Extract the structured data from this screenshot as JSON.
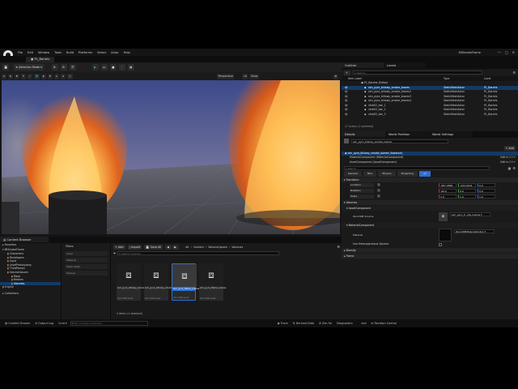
{
  "menu": [
    "File",
    "Edit",
    "Window",
    "Tools",
    "Build",
    "Platforms",
    "Select",
    "Actor",
    "Help"
  ],
  "window_title": "MISmokeFlame",
  "level_tab": "PL_Barrels",
  "toolbar": {
    "mode": "Selection Mode"
  },
  "viewport": {
    "perspective": "Perspective",
    "lit": "Lit"
  },
  "outliner": {
    "title": "Outliner",
    "levels_tab": "Levels",
    "search_placeholder": "Search...",
    "columns": [
      "Item Label",
      "Type",
      "Level"
    ],
    "root": "PL_Barrels (Editor)",
    "rows": [
      {
        "label": "sim_pyro_billowy_smoke_lowres",
        "type": "StaticMeshActor",
        "level": "PL_Barrels"
      },
      {
        "label": "sim_pyro_billowy_smoke_lowres2",
        "type": "StaticMeshActor",
        "level": "PL_Barrels"
      },
      {
        "label": "sim_pyro_billowy_smoke_lowres3",
        "type": "StaticMeshActor",
        "level": "PL_Barrels"
      },
      {
        "label": "sim_pyro_billowy_smoke_lowres4",
        "type": "StaticMeshActor",
        "level": "PL_Barrels"
      },
      {
        "label": "vfxb02_bar_1",
        "type": "StaticMeshActor",
        "level": "PL_Barrels"
      },
      {
        "label": "vfxb02_bar_2",
        "type": "StaticMeshActor",
        "level": "PL_Barrels"
      },
      {
        "label": "vfxb02_bar_3",
        "type": "StaticMeshActor",
        "level": "PL_Barrels"
      }
    ],
    "footer": "17 actors (1 selected)"
  },
  "details": {
    "tabs": [
      "Details",
      "World Partition",
      "World Settings"
    ],
    "actor_name": "sim_pyro_billowy_smoke_lowres",
    "add_label": "Add",
    "components": [
      "sim_pyro_billowy_smoke_lowres (Instance)",
      "MaterialComponent (MaterialComponent)",
      "AssetComponent (AssetComponent)"
    ],
    "edit_in_cpp": "Edit in C++",
    "search_placeholder": "Search",
    "filter_tabs": [
      "General",
      "Misc",
      "Physics",
      "Streaming",
      "All"
    ],
    "transform": {
      "section": "Transform",
      "location_label": "Location",
      "location": [
        "-967.0884",
        "-294.9224",
        "0.0"
      ],
      "rotation_label": "Rotation",
      "rotation": [
        "-90.0",
        "0.0",
        "0.0"
      ],
      "scale_label": "Scale",
      "scale": [
        "1.0",
        "1.0",
        "1.0"
      ]
    },
    "volumes_section": "Volumes",
    "asset_section": "AssetComponent",
    "zero_vdb_label": "ZeroVDB Volume",
    "zero_vdb_value": "sim_pyro_b..olw_lowres",
    "material_section": "MaterialComponent",
    "material_label": "Material",
    "material_value": "ZeroVDBMaterialInstan",
    "use_hetero": "Use Heterogeneous Volume",
    "density_section": "Density",
    "flame_section": "Flame"
  },
  "content_browser": {
    "title": "Content Browser",
    "favorites": "Favorites",
    "root": "MISmokeFlame",
    "tree": [
      "Characters",
      "Developers",
      "Input",
      "LevelPrototyping",
      "ThirdPerson",
      "VolumeUpsam",
      "Maps",
      "Meshes",
      "Volumes",
      "Engine"
    ],
    "collections": "Collections",
    "filters_title": "Filters",
    "filters": [
      "Level",
      "Material",
      "Static Mesh",
      "Texture"
    ],
    "add_label": "Add",
    "import_label": "Import",
    "save_all_label": "Save All",
    "path": [
      "All",
      "Content",
      "VolumeUpsam",
      "Volumes"
    ],
    "search_placeholder": "Search Volumes",
    "assets": [
      {
        "name": "sim_pyro_billowy_smoke_lowres",
        "type": "ZeroVDB Asset"
      },
      {
        "name": "sim_pyro_billowy_smoke_flame",
        "type": "ZeroVDB Asset"
      },
      {
        "name": "sim_pyro_flame_lowres",
        "type": "ZeroVDB Asset"
      },
      {
        "name": "sim_pyro_flame_lowres",
        "type": "ZeroVDB Asset"
      }
    ],
    "status": "4 items (1 selected)"
  },
  "statusbar": {
    "content_drawer": "Content Drawer",
    "output_log": "Output Log",
    "cmd": "Cmd",
    "console_placeholder": "Enter Console Command",
    "trace": "Trace",
    "derived": "Derived Data",
    "zen": "Zen Server",
    "unsaved": "2 Unsaved",
    "revision": "Revision Control",
    "diagnostics": "Diagnostics"
  }
}
